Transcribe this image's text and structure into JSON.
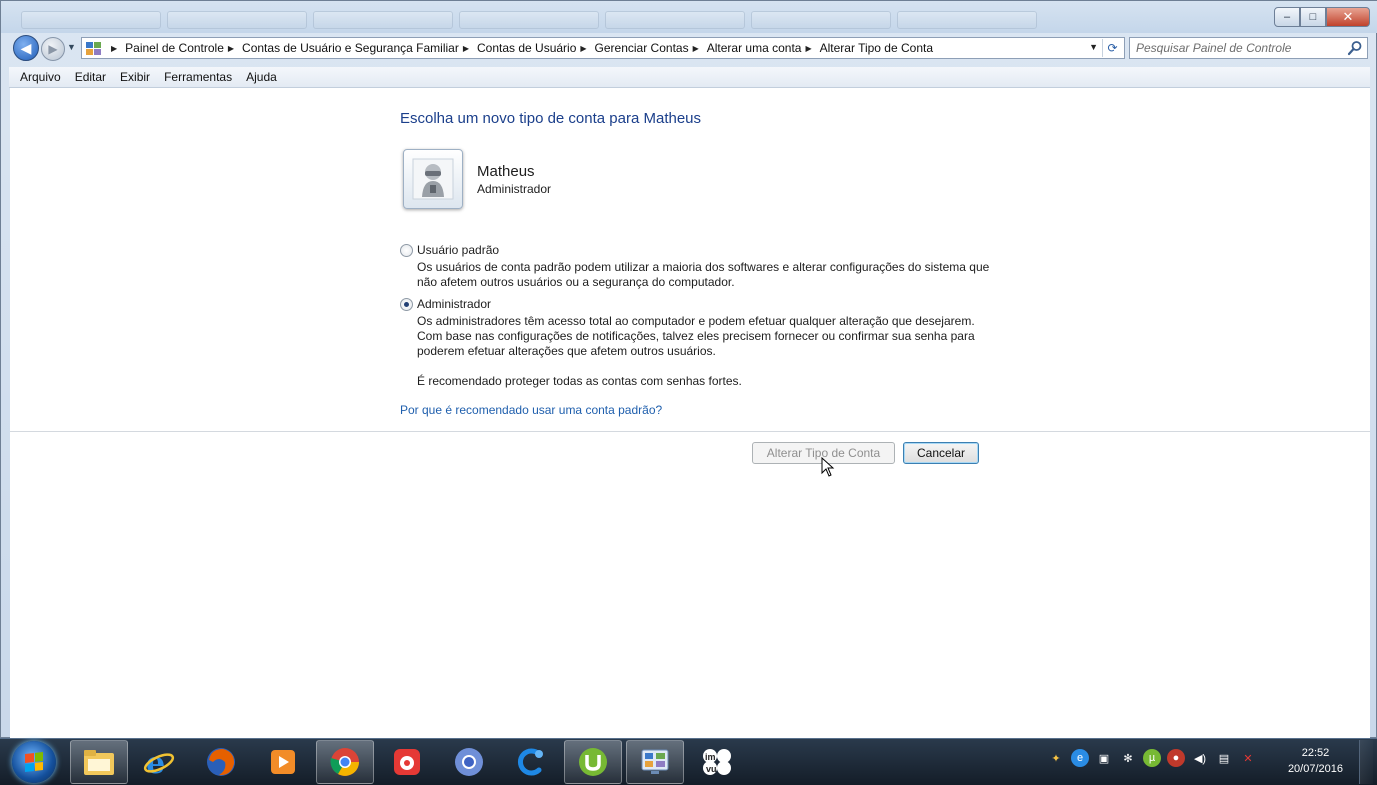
{
  "window": {
    "controls": {
      "minimize": "–",
      "maximize": "□",
      "close": "✕"
    }
  },
  "address_bar": {
    "breadcrumbs": [
      "Painel de Controle",
      "Contas de Usuário e Segurança Familiar",
      "Contas de Usuário",
      "Gerenciar Contas",
      "Alterar uma conta",
      "Alterar Tipo de Conta"
    ],
    "search_placeholder": "Pesquisar Painel de Controle"
  },
  "menu": [
    "Arquivo",
    "Editar",
    "Exibir",
    "Ferramentas",
    "Ajuda"
  ],
  "main": {
    "heading": "Escolha um novo tipo de conta para Matheus",
    "user": {
      "name": "Matheus",
      "role": "Administrador"
    },
    "options": [
      {
        "label": "Usuário padrão",
        "selected": false,
        "description": "Os usuários de conta padrão podem utilizar a maioria dos softwares e alterar configurações do sistema que não afetem outros usuários ou a segurança do computador."
      },
      {
        "label": "Administrador",
        "selected": true,
        "description": "Os administradores têm acesso total ao computador e podem efetuar qualquer alteração que desejarem. Com base nas configurações de notificações, talvez eles precisem fornecer ou confirmar sua senha para poderem efetuar alterações que afetem outros usuários."
      }
    ],
    "recommendation": "É recomendado proteger todas as contas com senhas fortes.",
    "help_link": "Por que é recomendado usar uma conta padrão?",
    "buttons": {
      "change": "Alterar Tipo de Conta",
      "cancel": "Cancelar"
    }
  },
  "taskbar": {
    "pinned": [
      "windows-explorer",
      "internet-explorer",
      "firefox",
      "media-player",
      "chrome",
      "app-red",
      "chromium",
      "app-blue-c",
      "utorrent",
      "control-panel",
      "imvu"
    ],
    "clock": {
      "time": "22:52",
      "date": "20/07/2016"
    }
  },
  "colors": {
    "heading": "#1b3f8b",
    "link": "#1f5fad",
    "taskbar": "#1b2633"
  }
}
